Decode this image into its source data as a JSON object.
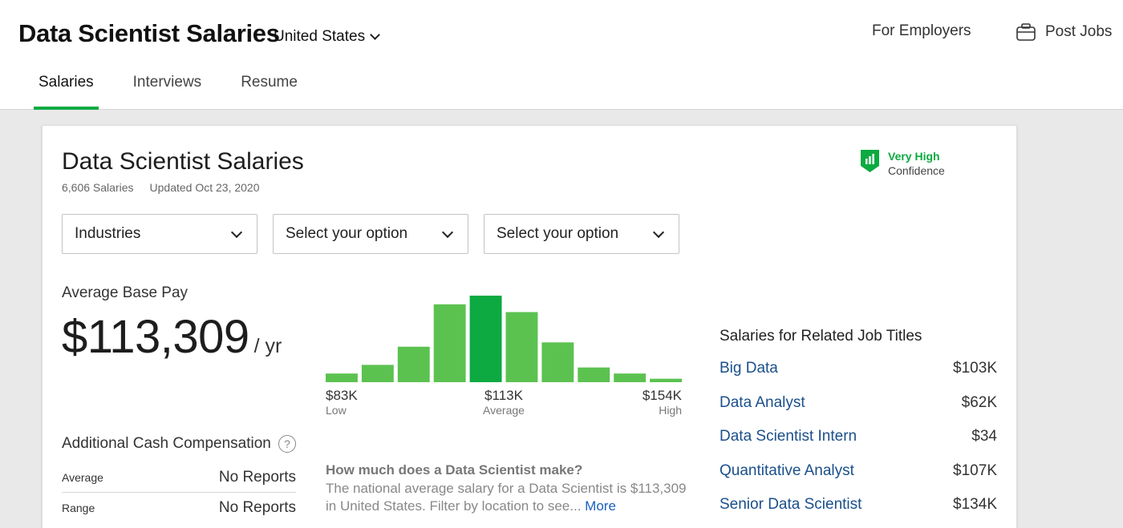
{
  "header": {
    "title": "Data Scientist Salaries",
    "location": "United States",
    "for_employers": "For Employers",
    "post_jobs": "Post Jobs"
  },
  "tabs": [
    {
      "label": "Salaries",
      "active": true
    },
    {
      "label": "Interviews",
      "active": false
    },
    {
      "label": "Resume",
      "active": false
    }
  ],
  "card": {
    "title": "Data Scientist Salaries",
    "salary_count": "6,606 Salaries",
    "updated": "Updated Oct 23, 2020",
    "confidence_level": "Very High",
    "confidence_label": "Confidence",
    "filters": [
      {
        "value": "Industries"
      },
      {
        "value": "Select your option"
      },
      {
        "value": "Select your option"
      }
    ],
    "avg_base_pay_label": "Average Base Pay",
    "avg_amount": "$113,309",
    "avg_unit": "/ yr",
    "low_value": "$83K",
    "low_label": "Low",
    "mid_value": "$113K",
    "mid_label": "Average",
    "high_value": "$154K",
    "high_label": "High",
    "additional_comp": {
      "title": "Additional Cash Compensation",
      "help": "?",
      "rows": [
        {
          "key": "Average",
          "value": "No Reports"
        },
        {
          "key": "Range",
          "value": "No Reports"
        }
      ]
    },
    "faq": {
      "question": "How much does a Data Scientist make?",
      "answer": "The national average salary for a Data Scientist is $113,309 in United States. Filter by location to see...",
      "more": "More"
    },
    "related": {
      "title": "Salaries for Related Job Titles",
      "items": [
        {
          "title": "Big Data",
          "value": "$103K"
        },
        {
          "title": "Data Analyst",
          "value": "$62K"
        },
        {
          "title": "Data Scientist Intern",
          "value": "$34"
        },
        {
          "title": "Quantitative Analyst",
          "value": "$107K"
        },
        {
          "title": "Senior Data Scientist",
          "value": "$134K"
        }
      ]
    }
  },
  "histogram": {
    "relative_heights": [
      0.1,
      0.2,
      0.41,
      0.9,
      1.0,
      0.81,
      0.46,
      0.17,
      0.1,
      0.04
    ],
    "highlight_index": 4,
    "color": "#5bc250",
    "highlight_color": "#0caa41"
  },
  "colors": {
    "accent": "#0caa41",
    "link": "#1a4f8b"
  }
}
